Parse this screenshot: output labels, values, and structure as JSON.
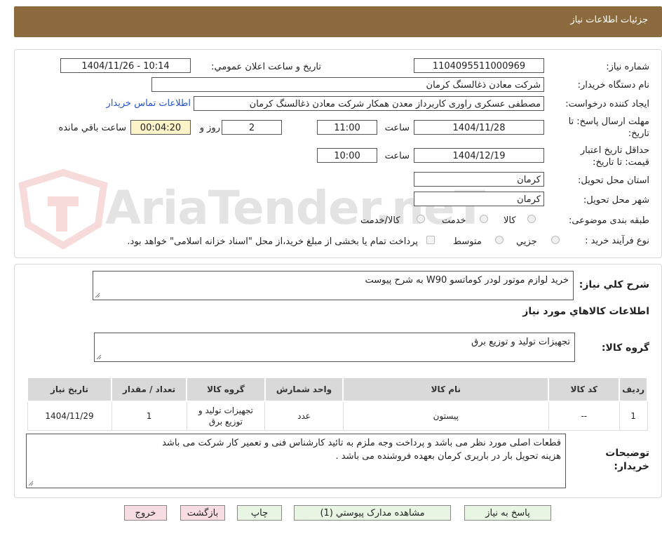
{
  "header": {
    "title": "جزئیات اطلاعات نیاز"
  },
  "fields": {
    "need_number_label": "شماره نیاز:",
    "need_number": "1104095511000969",
    "announce_label": "تاریخ و ساعت اعلان عمومي:",
    "announce_value": "1404/11/26 - 10:14",
    "buyer_org_label": "نام دستگاه خريدار:",
    "buyer_org": "شرکت معادن ذغالسنگ کرمان",
    "requester_label": "ايجاد کننده درخواست:",
    "requester": "مصطفی عسکری راوری کاربرداز معدن همکار  شرکت معادن ذغالسنگ کرمان",
    "contact_link": "اطلاعات تماس خريدار",
    "deadline_label_1": "مهلت ارسال پاسخ: تا",
    "deadline_label_2": "تاریخ:",
    "deadline_date": "1404/11/28",
    "time_label": "ساعت",
    "deadline_time": "11:00",
    "days_value": "2",
    "days_label": "روز و",
    "remaining_time": "00:04:20",
    "remaining_label": "ساعت باقي مانده",
    "validity_label_1": "حداقل تاريخ اعتبار",
    "validity_label_2": "قيمت: تا تاريخ:",
    "validity_date": "1404/12/19",
    "validity_time_label": "ساعت",
    "validity_time": "10:00",
    "province_label": "استان محل تحويل:",
    "province": "کرمان",
    "city_label": "شهر محل تحويل:",
    "city": "کرمان",
    "category_label": "طبقه بندی موضوعی:",
    "category_options": [
      "کالا",
      "خدمت",
      "کالا/خدمت"
    ],
    "process_label": "نوع فرآيند خريد :",
    "process_options": [
      "جزيي",
      "متوسط"
    ],
    "payment_note": "پرداخت تمام يا بخشی از مبلغ خريد،از محل \"اسناد خزانه اسلامی\" خواهد بود."
  },
  "summary": {
    "title_label": "شرح کلي نياز:",
    "title_value": "خرید لوازم موتور لودر کوماتسو W90 به شرح  پیوست",
    "goods_info_title": "اطلاعات کالاهاي مورد نياز",
    "group_label": "گروه کالا:",
    "group_value": "تجهیزات تولید و توزیع برق"
  },
  "table": {
    "headers": [
      "رديف",
      "کد کالا",
      "نام کالا",
      "واحد شمارش",
      "گروه کالا",
      "تعداد / مقدار",
      "تاریخ نیاز"
    ],
    "rows": [
      [
        "1",
        "--",
        "پیستون",
        "عدد",
        "تجهیزات تولید و توزیع برق",
        "1",
        "1404/11/29"
      ]
    ]
  },
  "notes": {
    "label_1": "توضيحات",
    "label_2": "خريدار:",
    "line_1": "قطعات اصلی مورد نظر می باشد و  پرداخت وجه ملزم به تائید کارشناس فنی و تعمیر کار شرکت می باشد",
    "line_2": "هزینه تحویل بار در باربری کرمان بعهده فروشنده می باشد ."
  },
  "buttons": {
    "reply": "پاسخ به نياز",
    "view_docs": "مشاهده مدارک پيوستي (1)",
    "print": "چاپ",
    "back": "بازگشت",
    "exit": "خروج"
  },
  "watermark": {
    "text": "AriaTender.neT"
  },
  "colors": {
    "header_bg": "#8b6a3e",
    "link": "#2255cc",
    "remaining_bg": "#fdf3c9",
    "btn_green": "#e8f5e3",
    "btn_pink": "#f7dde2"
  },
  "icons": {
    "resize_grip": "resize-grip-icon",
    "watermark_logo": "aria-shield-logo"
  }
}
